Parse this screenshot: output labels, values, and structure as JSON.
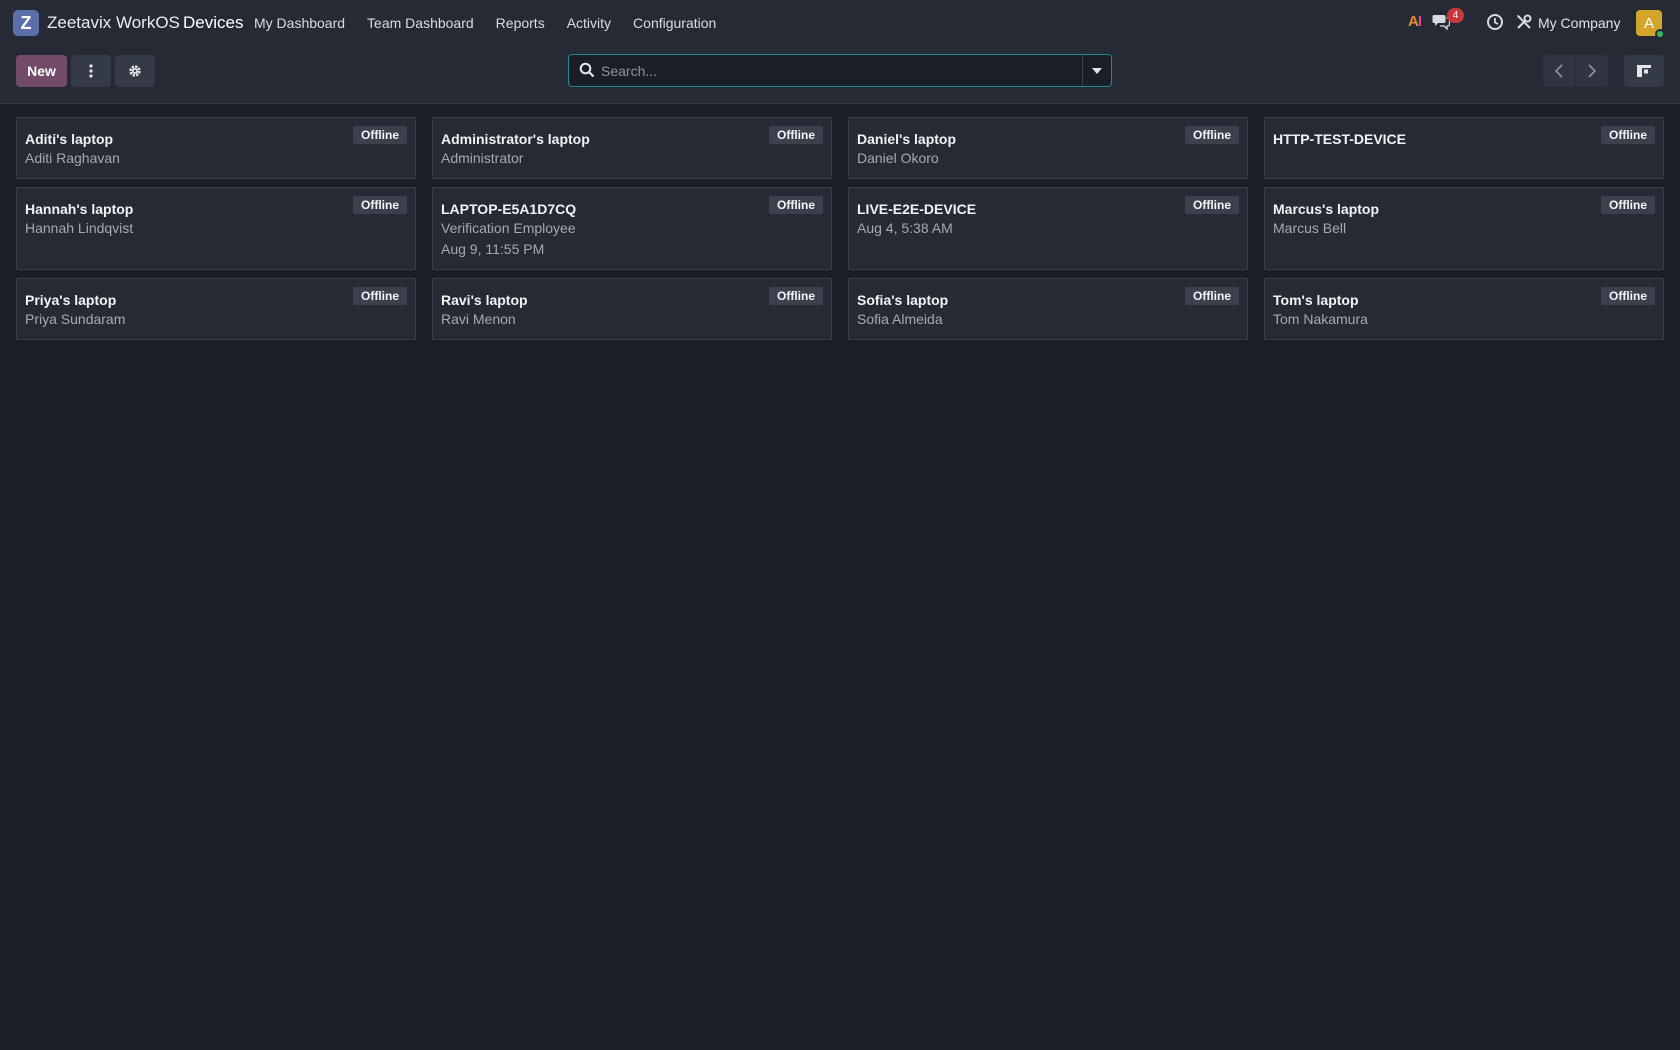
{
  "navbar": {
    "brand": "Zeetavix WorkOS",
    "logo_letter": "Z",
    "app_name": "Devices",
    "menu": [
      "My Dashboard",
      "Team Dashboard",
      "Reports",
      "Activity",
      "Configuration"
    ],
    "ai_label_a": "A",
    "ai_label_i": "I",
    "chat_badge": "4",
    "company": "My Company",
    "avatar_letter": "A"
  },
  "toolbar": {
    "new_label": "New",
    "search_placeholder": "Search..."
  },
  "colors": {
    "primary": "#714b67",
    "background": "#1b1e27",
    "card": "#262a35",
    "search_focus": "#1f8b8f",
    "badge": "#c9373a",
    "avatar": "#d4a52b",
    "presence": "#2ebd5a"
  },
  "devices": [
    {
      "name": "Aditi's laptop",
      "lines": [
        "Aditi Raghavan"
      ],
      "status": "Offline"
    },
    {
      "name": "Administrator's laptop",
      "lines": [
        "Administrator"
      ],
      "status": "Offline"
    },
    {
      "name": "Daniel's laptop",
      "lines": [
        "Daniel Okoro"
      ],
      "status": "Offline"
    },
    {
      "name": "HTTP-TEST-DEVICE",
      "lines": [],
      "status": "Offline"
    },
    {
      "name": "Hannah's laptop",
      "lines": [
        "Hannah Lindqvist"
      ],
      "status": "Offline"
    },
    {
      "name": "LAPTOP-E5A1D7CQ",
      "lines": [
        "Verification Employee",
        "Aug 9, 11:55 PM"
      ],
      "status": "Offline"
    },
    {
      "name": "LIVE-E2E-DEVICE",
      "lines": [
        "Aug 4, 5:38 AM"
      ],
      "status": "Offline"
    },
    {
      "name": "Marcus's laptop",
      "lines": [
        "Marcus Bell"
      ],
      "status": "Offline"
    },
    {
      "name": "Priya's laptop",
      "lines": [
        "Priya Sundaram"
      ],
      "status": "Offline"
    },
    {
      "name": "Ravi's laptop",
      "lines": [
        "Ravi Menon"
      ],
      "status": "Offline"
    },
    {
      "name": "Sofia's laptop",
      "lines": [
        "Sofia Almeida"
      ],
      "status": "Offline"
    },
    {
      "name": "Tom's laptop",
      "lines": [
        "Tom Nakamura"
      ],
      "status": "Offline"
    }
  ]
}
